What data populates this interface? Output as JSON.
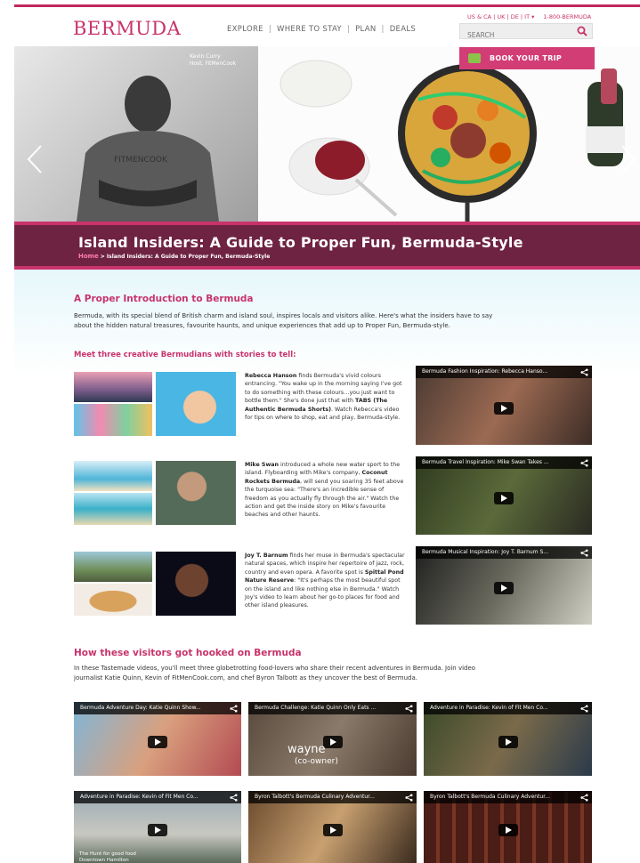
{
  "header": {
    "logo": "BERMUDA",
    "nav": [
      "EXPLORE",
      "WHERE TO STAY",
      "PLAN",
      "DEALS"
    ],
    "nav_sep": "|",
    "locales": "US & CA | UK | DE | IT ▾",
    "phone": "1-800-BERMUDA",
    "search_placeholder": "SEARCH"
  },
  "hero": {
    "host_name": "Kevin Curry",
    "host_title": "Host, FitMenCook",
    "book_label": "BOOK YOUR TRIP",
    "title": "Island Insiders: A Guide to Proper Fun, Bermuda-Style",
    "breadcrumb_home": "Home",
    "breadcrumb_current": " > Island Insiders: A Guide to Proper Fun, Bermuda-Style"
  },
  "intro": {
    "heading": "A Proper Introduction to Bermuda",
    "text": "Bermuda, with its special blend of British charm and island soul, inspires locals and visitors alike. Here's what the insiders have to say about the hidden natural treasures, favourite haunts, and unique experiences that add up to Proper Fun, Bermuda-style."
  },
  "meet": {
    "heading": "Meet three creative Bermudians with stories to tell:"
  },
  "stories": [
    {
      "name": "Rebecca Hanson",
      "text": " finds Bermuda's vivid colours entrancing. \"You wake up in the morning saying I've got to do something with these colours…you just want to bottle them.\" She's done just that with ",
      "bold2": "TABS (The Authentic Bermuda Shorts)",
      "text2": ". Watch Rebecca's video for tips on where to shop, eat and play, Bermuda-style.",
      "video_title": "Bermuda Fashion Inspiration: Rebecca Hanso..."
    },
    {
      "name": "Mike Swan",
      "text": " introduced a whole new water sport to the island. Flyboarding with Mike's company, ",
      "bold2": "Coconut Rockets Bermuda",
      "text2": ", will send you soaring 35 feet above the turquoise sea: \"There's an incredible sense of freedom as you actually fly through the air.\" Watch the action and get the inside story on Mike's favourite beaches and other haunts.",
      "video_title": "Bermuda Travel Inspiration: Mike Swan Takes ..."
    },
    {
      "name": "Joy T. Barnum",
      "text": " finds her muse in Bermuda's spectacular natural spaces, which inspire her repertoire of jazz, rock, country and even opera. A favorite spot is ",
      "bold2": "Spittal Pond Nature Reserve",
      "text2": ": \"It's perhaps the most beautiful spot on the island and like nothing else in Bermuda.\" Watch Joy's video to learn about her go-to places for food and other island pleasures.",
      "video_title": "Bermuda Musical Inspiration: Joy T. Barnum S..."
    }
  ],
  "hooked": {
    "heading": "How these visitors got hooked on Bermuda",
    "text": "In these Tastemade videos, you'll meet three globetrotting food-lovers who share their recent adventures in Bermuda. Join video journalist Katie Quinn, Kevin of FitMenCook.com, and chef Byron Talbott as they uncover the best of Bermuda."
  },
  "videos": [
    {
      "title": "Bermuda Adventure Day: Katie Quinn Show..."
    },
    {
      "title": "Bermuda Challenge: Katie Quinn Only Eats ...",
      "overlay": "wayne",
      "overlay2": "(co-owner)"
    },
    {
      "title": "Adventure in Paradise: Kevin of Fit Men Co..."
    },
    {
      "title": "Adventure in Paradise: Kevin of Fit Men Co...",
      "overlay": "The Hunt for good food",
      "overlay2": "Downtown Hamilton"
    },
    {
      "title": "Byron Talbott's Bermuda Culinary Adventur..."
    },
    {
      "title": "Byron Talbott's Bermuda Culinary Adventur..."
    }
  ],
  "colors": {
    "brand": "#c8336b",
    "band": "#6f2342"
  }
}
